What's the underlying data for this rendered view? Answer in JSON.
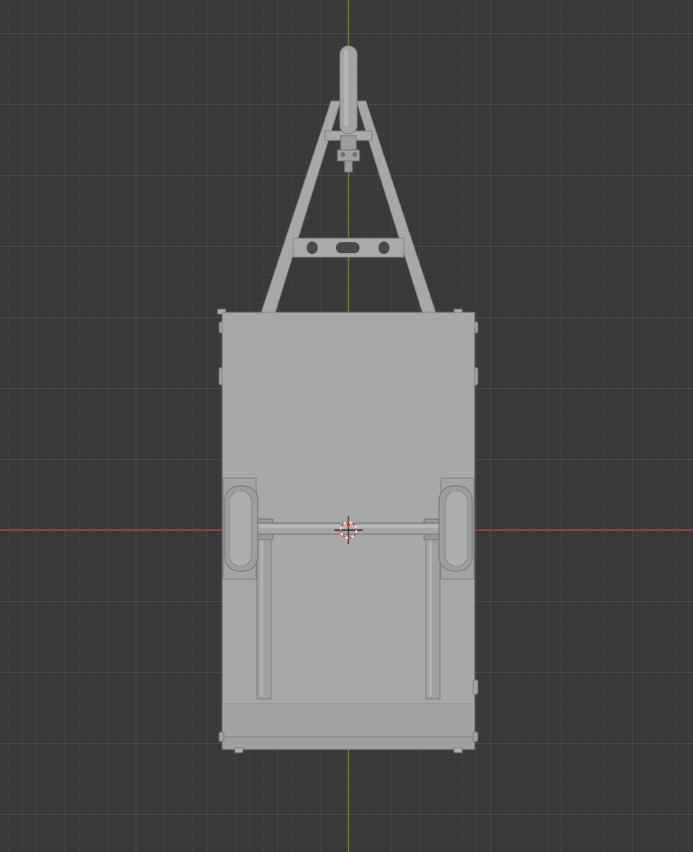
{
  "viewport": {
    "view": "top-orthographic",
    "background": "#393939",
    "grid_major": "#4a4a4a",
    "grid_minor": "#404040",
    "x_axis_color": "#c0454b",
    "y_axis_color": "#7aa32a"
  },
  "model": {
    "object": "trailer",
    "base_color": "#a7a8a9",
    "shade_color": "#9a9b9c",
    "edge_color": "#7c7d7e"
  },
  "cursor": {
    "icon": "3d-cursor-icon",
    "ring_colors": [
      "#d9442f",
      "#f0f0f0"
    ]
  }
}
